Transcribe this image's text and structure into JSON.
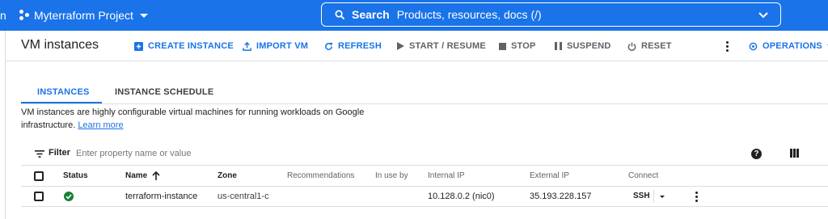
{
  "topbar": {
    "edge_glyph": "n",
    "project_name": "Myterraform Project",
    "search": {
      "label": "Search",
      "placeholder": "Products, resources, docs (/)"
    }
  },
  "toolbar": {
    "page_title": "VM instances",
    "create_instance": "CREATE INSTANCE",
    "import_vm": "IMPORT VM",
    "refresh": "REFRESH",
    "start_resume": "START / RESUME",
    "stop": "STOP",
    "suspend": "SUSPEND",
    "reset": "RESET",
    "operations": "OPERATIONS"
  },
  "tabs": [
    {
      "label": "INSTANCES",
      "active": true
    },
    {
      "label": "INSTANCE SCHEDULE",
      "active": false
    }
  ],
  "description": {
    "text": "VM instances are highly configurable virtual machines for running workloads on Google infrastructure.",
    "link": "Learn more"
  },
  "filter": {
    "label": "Filter",
    "placeholder": "Enter property name or value"
  },
  "table": {
    "columns": [
      "Status",
      "Name",
      "Zone",
      "Recommendations",
      "In use by",
      "Internal IP",
      "External IP",
      "Connect"
    ],
    "rows": [
      {
        "status": "running",
        "name": "terraform-instance",
        "zone": "us-central1-c",
        "recommendations": "",
        "in_use_by": "",
        "internal_ip": "10.128.0.2 (nic0)",
        "external_ip": "35.193.228.157",
        "connect": "SSH"
      }
    ]
  },
  "colors": {
    "brand_blue": "#1a73e8",
    "status_green": "#188038",
    "divider": "#dadce0"
  }
}
